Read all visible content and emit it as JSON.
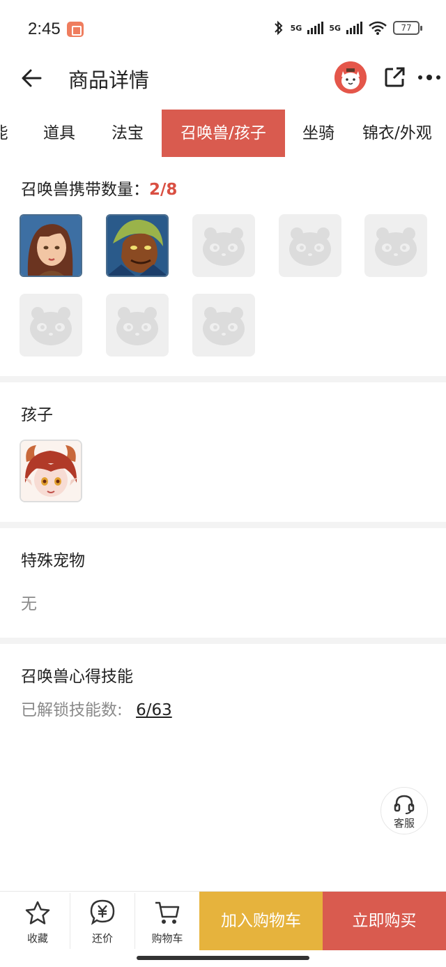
{
  "status_bar": {
    "time": "2:45",
    "network_1": "5G",
    "network_2": "5G",
    "battery": "77"
  },
  "header": {
    "title": "商品详情"
  },
  "tabs": [
    {
      "label": "能"
    },
    {
      "label": "道具"
    },
    {
      "label": "法宝"
    },
    {
      "label": "召唤兽/孩子",
      "active": true
    },
    {
      "label": "坐骑"
    },
    {
      "label": "锦衣/外观"
    }
  ],
  "summons": {
    "title": "召唤兽携带数量：",
    "count": "2/8",
    "slots": [
      {
        "icon": "female-character-avatar",
        "filled": true
      },
      {
        "icon": "beast-warrior-avatar",
        "filled": true
      },
      {
        "icon": "panda-placeholder-icon",
        "filled": false
      },
      {
        "icon": "panda-placeholder-icon",
        "filled": false
      },
      {
        "icon": "panda-placeholder-icon",
        "filled": false
      },
      {
        "icon": "panda-placeholder-icon",
        "filled": false
      },
      {
        "icon": "panda-placeholder-icon",
        "filled": false
      },
      {
        "icon": "panda-placeholder-icon",
        "filled": false
      }
    ]
  },
  "children": {
    "title": "孩子",
    "items": [
      {
        "icon": "horned-child-avatar"
      }
    ]
  },
  "special_pets": {
    "title": "特殊宠物",
    "value": "无"
  },
  "skills": {
    "title": "召唤兽心得技能",
    "unlocked_label": "已解锁技能数:",
    "unlocked_value": "6/63"
  },
  "service": {
    "label": "客服"
  },
  "bottom_bar": {
    "favorite": "收藏",
    "bargain": "还价",
    "cart": "购物车",
    "add_to_cart": "加入购物车",
    "buy_now": "立即购买"
  },
  "colors": {
    "accent_red": "#d95b4f",
    "accent_yellow": "#e6b33d"
  }
}
